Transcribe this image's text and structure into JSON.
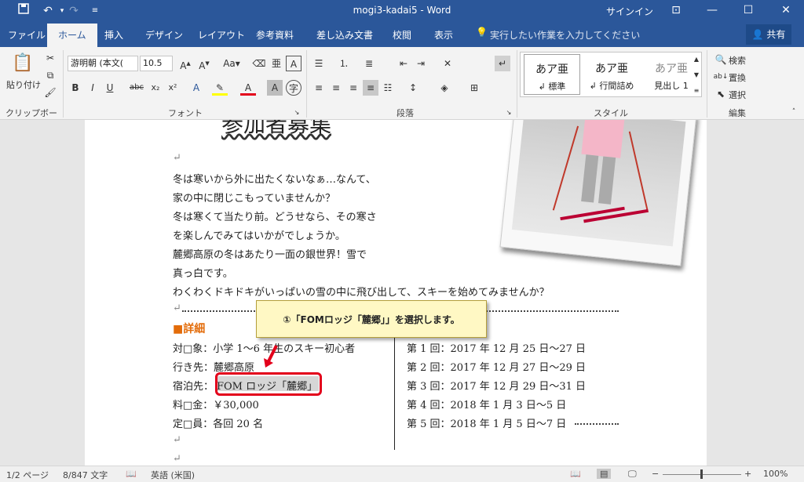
{
  "window": {
    "title": "mogi3-kadai5  -  Word",
    "signin": "サインイン",
    "icons": {
      "save": "save-icon",
      "undo": "undo-icon",
      "redo": "redo-icon",
      "customize": "customize-icon"
    }
  },
  "tabs": {
    "file": "ファイル",
    "home": "ホーム",
    "insert": "挿入",
    "design": "デザイン",
    "layout": "レイアウト",
    "references": "参考資料",
    "mailings": "差し込み文書",
    "review": "校閲",
    "view": "表示",
    "tellme": "実行したい作業を入力してください",
    "share": "共有"
  },
  "ribbon": {
    "clipboard": {
      "paste": "貼り付け",
      "label": "クリップボード"
    },
    "font": {
      "name": "游明朝 (本文(",
      "size": "10.5",
      "label": "フォント",
      "bold": "B",
      "italic": "I",
      "underline": "U",
      "strike": "abc"
    },
    "paragraph": {
      "label": "段落"
    },
    "styles": {
      "label": "スタイル",
      "items": [
        {
          "sample": "あア亜",
          "name": "↲ 標準"
        },
        {
          "sample": "あア亜",
          "name": "↲ 行間詰め"
        },
        {
          "sample": "あア亜",
          "name": "見出し 1"
        }
      ]
    },
    "editing": {
      "find": "検索",
      "replace": "置換",
      "select": "選択",
      "label": "編集"
    }
  },
  "document": {
    "title": "参加者募集",
    "intro": [
      "冬は寒いから外に出たくないなぁ…なんて、",
      "家の中に閉じこもっていませんか？",
      "冬は寒くて当たり前。どうせなら、その寒さ",
      "を楽しんでみてはいかがでしょうか。",
      "麓郷高原の冬はあたり一面の銀世界！雪で",
      "真っ白です。",
      "わくわくドキドキがいっぱいの雪の中に飛び出して、スキーを始めてみませんか？"
    ],
    "section_heading": "■詳細",
    "details": [
      "対□象：小学 1～6 年生のスキー初心者",
      "行き先：麓郷高原",
      "宿泊先：",
      "料□金：￥30,000",
      "定□員：各回 20 名"
    ],
    "lodging": "FOM ロッジ「麓郷」",
    "schedule": [
      "第 1 回：2017 年 12 月 25 日～27 日",
      "第 2 回：2017 年 12 月 27 日～29 日",
      "第 3 回：2017 年 12 月 29 日～31 日",
      "第 4 回：2018 年 1 月 3 日～5 日",
      "第 5 回：2018 年 1 月 5 日～7 日"
    ],
    "paragraph_mark": "↵"
  },
  "callout": {
    "text": "①「FOMロッジ「麓郷」」を選択します。"
  },
  "status": {
    "page": "1/2 ページ",
    "words": "8/847 文字",
    "language": "英語 (米国)",
    "zoom": "100%"
  },
  "colors": {
    "accent": "#2b579a",
    "heading": "#e36c0a",
    "highlight": "#e3001b",
    "callout_bg": "#fff8c4"
  }
}
